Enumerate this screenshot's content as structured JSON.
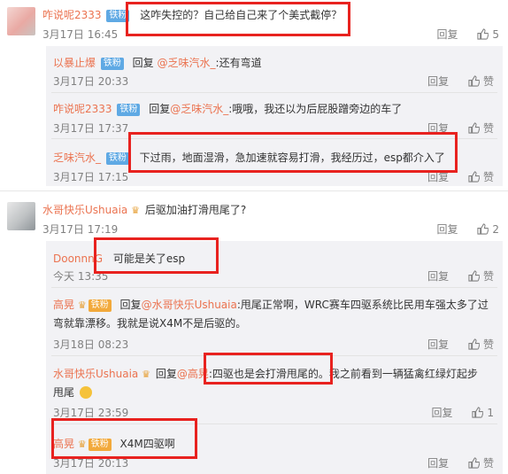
{
  "comments": [
    {
      "user": "咋说呢2333",
      "badge": "铁粉",
      "text": "这咋失控的？自己给自己来了个美式截停？",
      "time": "3月17日 16:45",
      "reply_label": "回复",
      "likes": "5",
      "replies": [
        {
          "user": "以暴止爆",
          "badge": "铁粉",
          "reply_word": "回复",
          "target": "@乏味汽水_",
          "text": ":还有弯道",
          "time": "3月17日 20:33",
          "reply_label": "回复",
          "like_label": "赞"
        },
        {
          "user": "咋说呢2333",
          "badge": "铁粉",
          "reply_word": "回复",
          "target": "@乏味汽水_",
          "text": ":哦哦，我还以为后屁股蹭旁边的车了",
          "time": "3月17日 17:37",
          "reply_label": "回复",
          "like_label": "赞"
        },
        {
          "user": "乏味汽水_",
          "badge": "铁粉",
          "text": "下过雨，地面湿滑，急加速就容易打滑，我经历过，esp都介入了",
          "time": "3月17日 17:15",
          "reply_label": "回复",
          "like_label": "赞"
        }
      ]
    },
    {
      "user": "水哥快乐Ushuaia",
      "text": "后驱加油打滑甩尾了?",
      "time": "3月17日 17:19",
      "reply_label": "回复",
      "likes": "2",
      "replies": [
        {
          "user": "DoonnnG",
          "text": "可能是关了esp",
          "time": "今天 13:35",
          "reply_label": "回复",
          "like_label": "赞"
        },
        {
          "user": "高晃",
          "badge": "铁粉",
          "reply_word": "回复",
          "target": "@水哥快乐Ushuaia",
          "text": ":甩尾正常啊，WRC赛车四驱系统比民用车强太多了过",
          "text2": "弯就靠漂移。我就是说X4M不是后驱的。",
          "time": "3月18日 08:23",
          "reply_label": "回复",
          "like_label": "赞"
        },
        {
          "user": "水哥快乐Ushuaia",
          "reply_word": "回复",
          "target": "@高晃",
          "text": ":四驱也是会打滑甩尾的。我之前看到一辆猛禽红绿灯起步",
          "text2": "甩尾",
          "time": "3月17日 23:59",
          "reply_label": "回复",
          "likes": "1"
        },
        {
          "user": "高晃",
          "badge": "铁粉",
          "text": "X4M四驱啊",
          "time": "3月17日 20:13",
          "reply_label": "回复",
          "like_label": "赞"
        }
      ]
    }
  ],
  "colors": {
    "username": "#eb7350",
    "mention": "#507daf",
    "badge": "#5fa9e4",
    "highlight_box": "#e8221f",
    "sub_bg": "#f2f2f5"
  }
}
